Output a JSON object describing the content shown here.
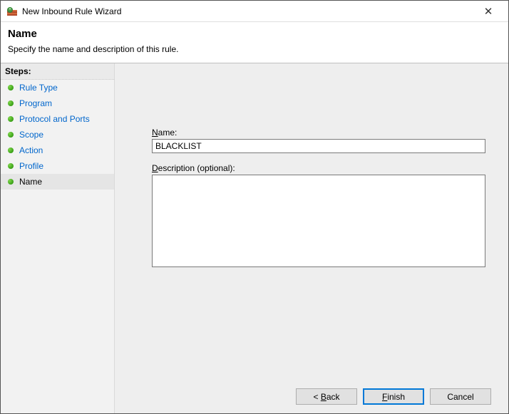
{
  "window": {
    "title": "New Inbound Rule Wizard"
  },
  "header": {
    "title": "Name",
    "subtitle": "Specify the name and description of this rule."
  },
  "sidebar": {
    "steps_label": "Steps:",
    "items": [
      {
        "label": "Rule Type",
        "active": false
      },
      {
        "label": "Program",
        "active": false
      },
      {
        "label": "Protocol and Ports",
        "active": false
      },
      {
        "label": "Scope",
        "active": false
      },
      {
        "label": "Action",
        "active": false
      },
      {
        "label": "Profile",
        "active": false
      },
      {
        "label": "Name",
        "active": true
      }
    ]
  },
  "form": {
    "name_label_prefix": "N",
    "name_label_rest": "ame:",
    "name_value": "BLACKLIST",
    "desc_label_prefix": "D",
    "desc_label_rest": "escription (optional):",
    "desc_value": ""
  },
  "buttons": {
    "back_prefix": "< ",
    "back_u": "B",
    "back_rest": "ack",
    "finish_u": "F",
    "finish_rest": "inish",
    "cancel": "Cancel"
  }
}
